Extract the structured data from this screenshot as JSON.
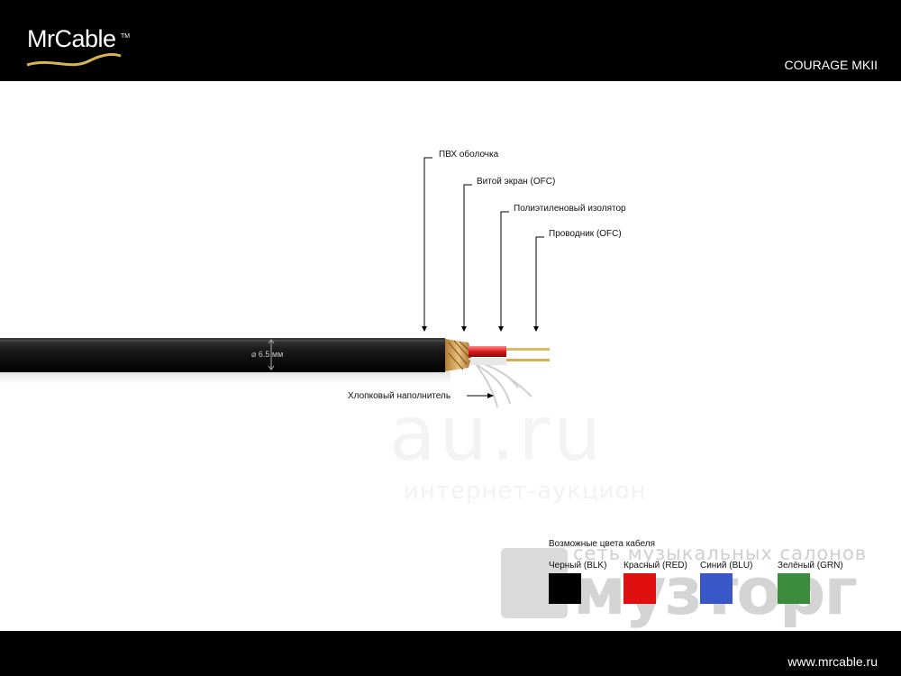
{
  "header": {
    "logo_text": "MrCable",
    "logo_tm": "TM",
    "model": "COURAGE MKII"
  },
  "diagram": {
    "callouts": [
      {
        "label": "ПВХ оболочка"
      },
      {
        "label": "Витой экран (OFC)"
      },
      {
        "label": "Полиэтиленовый изолятор"
      },
      {
        "label": "Проводник (OFC)"
      }
    ],
    "diameter_label": "⌀ 6.5 мм",
    "filler_label": "Хлопковый наполнитель"
  },
  "colors_section": {
    "title": "Возможные цвета кабеля",
    "options": [
      {
        "label": "Черный (BLK)",
        "color": "#000000"
      },
      {
        "label": "Красный (RED)",
        "color": "#e01010"
      },
      {
        "label": "Синий (BLU)",
        "color": "#3a57c8"
      },
      {
        "label": "Зелёный (GRN)",
        "color": "#3d8c3d"
      }
    ]
  },
  "watermarks": {
    "site": "au.ru",
    "site_sub": "интернет-аукцион",
    "store_top": "сеть музыкальных салонов",
    "store_name": "музторг"
  },
  "footer": {
    "url": "www.mrcable.ru"
  }
}
